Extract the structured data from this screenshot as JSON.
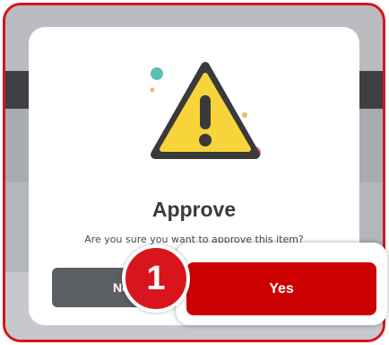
{
  "dialog": {
    "title": "Approve",
    "message": "Are you sure you want to approve this item?",
    "icon": "warning-triangle-icon"
  },
  "buttons": {
    "no_label": "No",
    "yes_label": "Yes"
  },
  "annotation": {
    "step_number": "1"
  },
  "colors": {
    "frame_border": "#d8151c",
    "yes_button": "#cc0000",
    "no_button": "#5b5f64",
    "warning_fill": "#f7d43a"
  }
}
